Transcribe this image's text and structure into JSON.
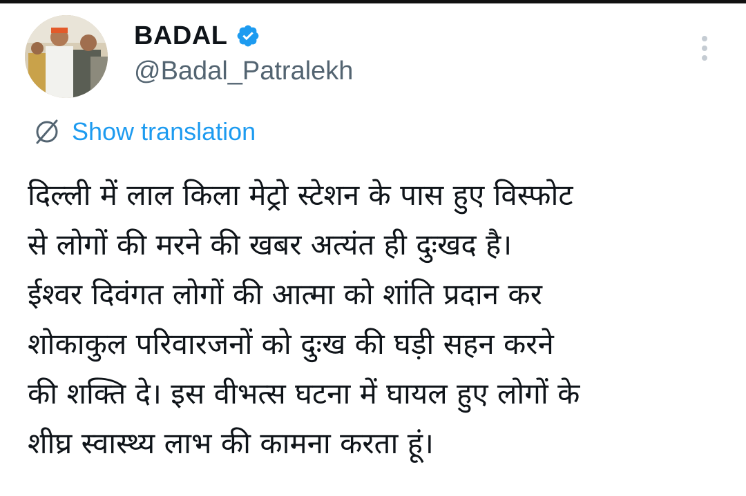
{
  "author": {
    "display_name": "BADAL",
    "handle": "@Badal_Patralekh",
    "verified": true,
    "verified_color": "#1d9bf0"
  },
  "icons": {
    "verified": "verified-badge-icon",
    "translate": "translate-globe-icon",
    "more": "more-vertical-icon"
  },
  "translation": {
    "label": "Show translation"
  },
  "tweet": {
    "lines": [
      "दिल्ली में लाल किला मेट्रो स्टेशन के पास हुए विस्फोट",
      "से लोगों की मरने की खबर अत्यंत ही दुःखद है।",
      "ईश्वर दिवंगत लोगों की आत्मा को शांति प्रदान कर",
      "शोकाकुल परिवारजनों को दुःख की घड़ी सहन करने",
      "की शक्ति दे। इस वीभत्स घटना में घायल हुए लोगों के",
      "शीघ्र स्वास्थ्य लाभ की कामना करता हूं।"
    ]
  },
  "colors": {
    "text": "#0f1419",
    "secondary": "#536471",
    "link": "#1d9bf0",
    "dots": "#c5ccd3"
  }
}
